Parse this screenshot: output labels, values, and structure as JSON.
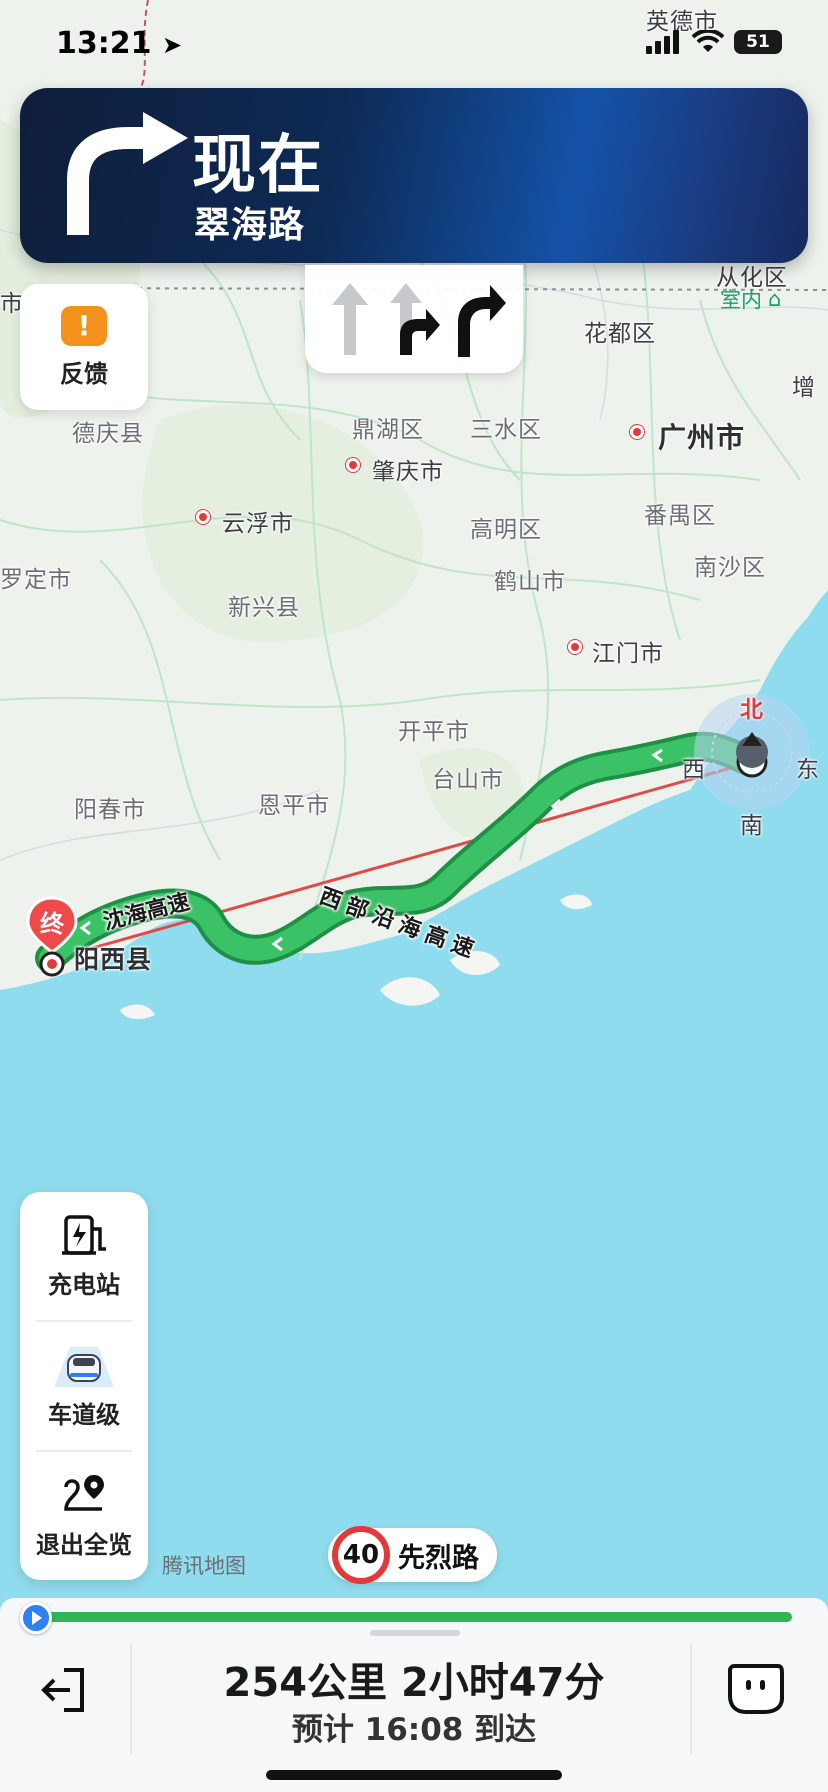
{
  "status_bar": {
    "time": "13:21",
    "battery": "51"
  },
  "guidance": {
    "when": "现在",
    "street": "翠海路"
  },
  "feedback": {
    "label": "反馈"
  },
  "indoor": {
    "label": "室内"
  },
  "map": {
    "places": [
      "英德市",
      "从化区",
      "花都区",
      "增",
      "德庆县",
      "鼎湖区",
      "三水区",
      "广州市",
      "肇庆市",
      "云浮市",
      "高明区",
      "番禺区",
      "罗定市",
      "鹤山市",
      "南沙区",
      "新兴县",
      "江门市",
      "开平市",
      "台山市",
      "阳春市",
      "恩平市",
      "阳西县",
      "市"
    ],
    "roads": [
      "沈海高速",
      "西部沿海高速"
    ],
    "compass": {
      "north": "北",
      "east": "东",
      "south": "南",
      "west": "西"
    },
    "end_marker": "终",
    "watermark": "腾讯地图"
  },
  "tools": {
    "charging": "充电站",
    "lane_level": "车道级",
    "exit_overview": "退出全览"
  },
  "speed": {
    "limit": "40",
    "road": "先烈路"
  },
  "trip": {
    "distance": "254公里",
    "duration": "2小时47分",
    "eta": "预计 16:08 到达"
  },
  "colors": {
    "route": "#2fb457",
    "sea": "#8fdcee",
    "accent": "#2f7ff6"
  }
}
